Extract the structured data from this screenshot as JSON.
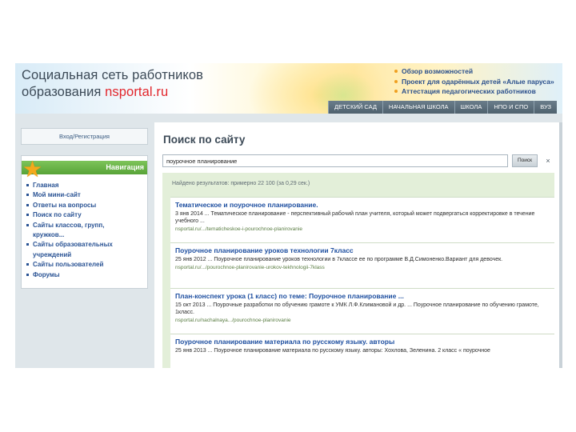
{
  "header": {
    "logo_line1": "Социальная сеть работников",
    "logo_line2_prefix": "образования ",
    "logo_brand": "nsportal",
    "logo_tld": ".ru",
    "promo_links": [
      "Обзор возможностей",
      "Проект для одарённых детей «Алые паруса»",
      "Аттестация педагогических работников"
    ],
    "tabs": [
      "ДЕТСКИЙ САД",
      "НАЧАЛЬНАЯ ШКОЛА",
      "ШКОЛА",
      "НПО И СПО",
      "ВУЗ"
    ]
  },
  "sidebar": {
    "login_label": "Вход/Регистрация",
    "nav_title": "Навигация",
    "nav_items": [
      "Главная",
      "Мой мини-сайт",
      "Ответы на вопросы",
      "Поиск по сайту",
      "Сайты классов, групп,",
      "кружков...",
      "Сайты образовательных",
      "учреждений",
      "Сайты пользователей",
      "Форумы"
    ]
  },
  "main": {
    "page_title": "Поиск по сайту",
    "search_value": "поурочное планирование",
    "search_button": "Поиск",
    "close_glyph": "×",
    "results_count": "Найдено результатов: примерно 22 100 (за 0,29 сек.)",
    "results": [
      {
        "title": "Тематическое и поурочное планирование.",
        "snippet": "3 янв 2014 ... Тематическое планирование - перспективный рабочий план учителя, который может подвергаться корректировке в течение учебного ...",
        "url": "nsportal.ru/.../tematicheskoe-i-pourochnoe-planirovanie"
      },
      {
        "title": "Поурочное планирование уроков технологии 7класс",
        "snippet": "25 янв 2012 ... Поурочное планирование уроков технологии в 7классе ее по программе В.Д.Симоненко.Вариант для девочек.",
        "url": "nsportal.ru/.../pourochnoe-planirovanie-urokov-tekhnologii-7klass"
      },
      {
        "title": "План-конспект урока (1 класс) по теме: Поурочное планирование ...",
        "snippet": "15 окт 2013 ... Поурочные разработки по обучению грамоте к УМК Л.Ф.Климановой и др. ... Поурочное планирование по обучению грамоте, 1класс.",
        "url": "nsportal.ru/nachalnaya.../pourochnoe-planirovanie"
      },
      {
        "title": "Поурочное планирование материала по русскому языку. авторы",
        "snippet": "25 янв 2013 ... Поурочное планирование материала по русскому языку. авторы: Хохлова, Зеленина. 2 класс « поурочное",
        "url": ""
      }
    ]
  },
  "colors": {
    "brand_red": "#e2262c",
    "nav_green": "#58a338",
    "link_blue": "#1e4fa0",
    "results_bg": "#e3efd9"
  }
}
